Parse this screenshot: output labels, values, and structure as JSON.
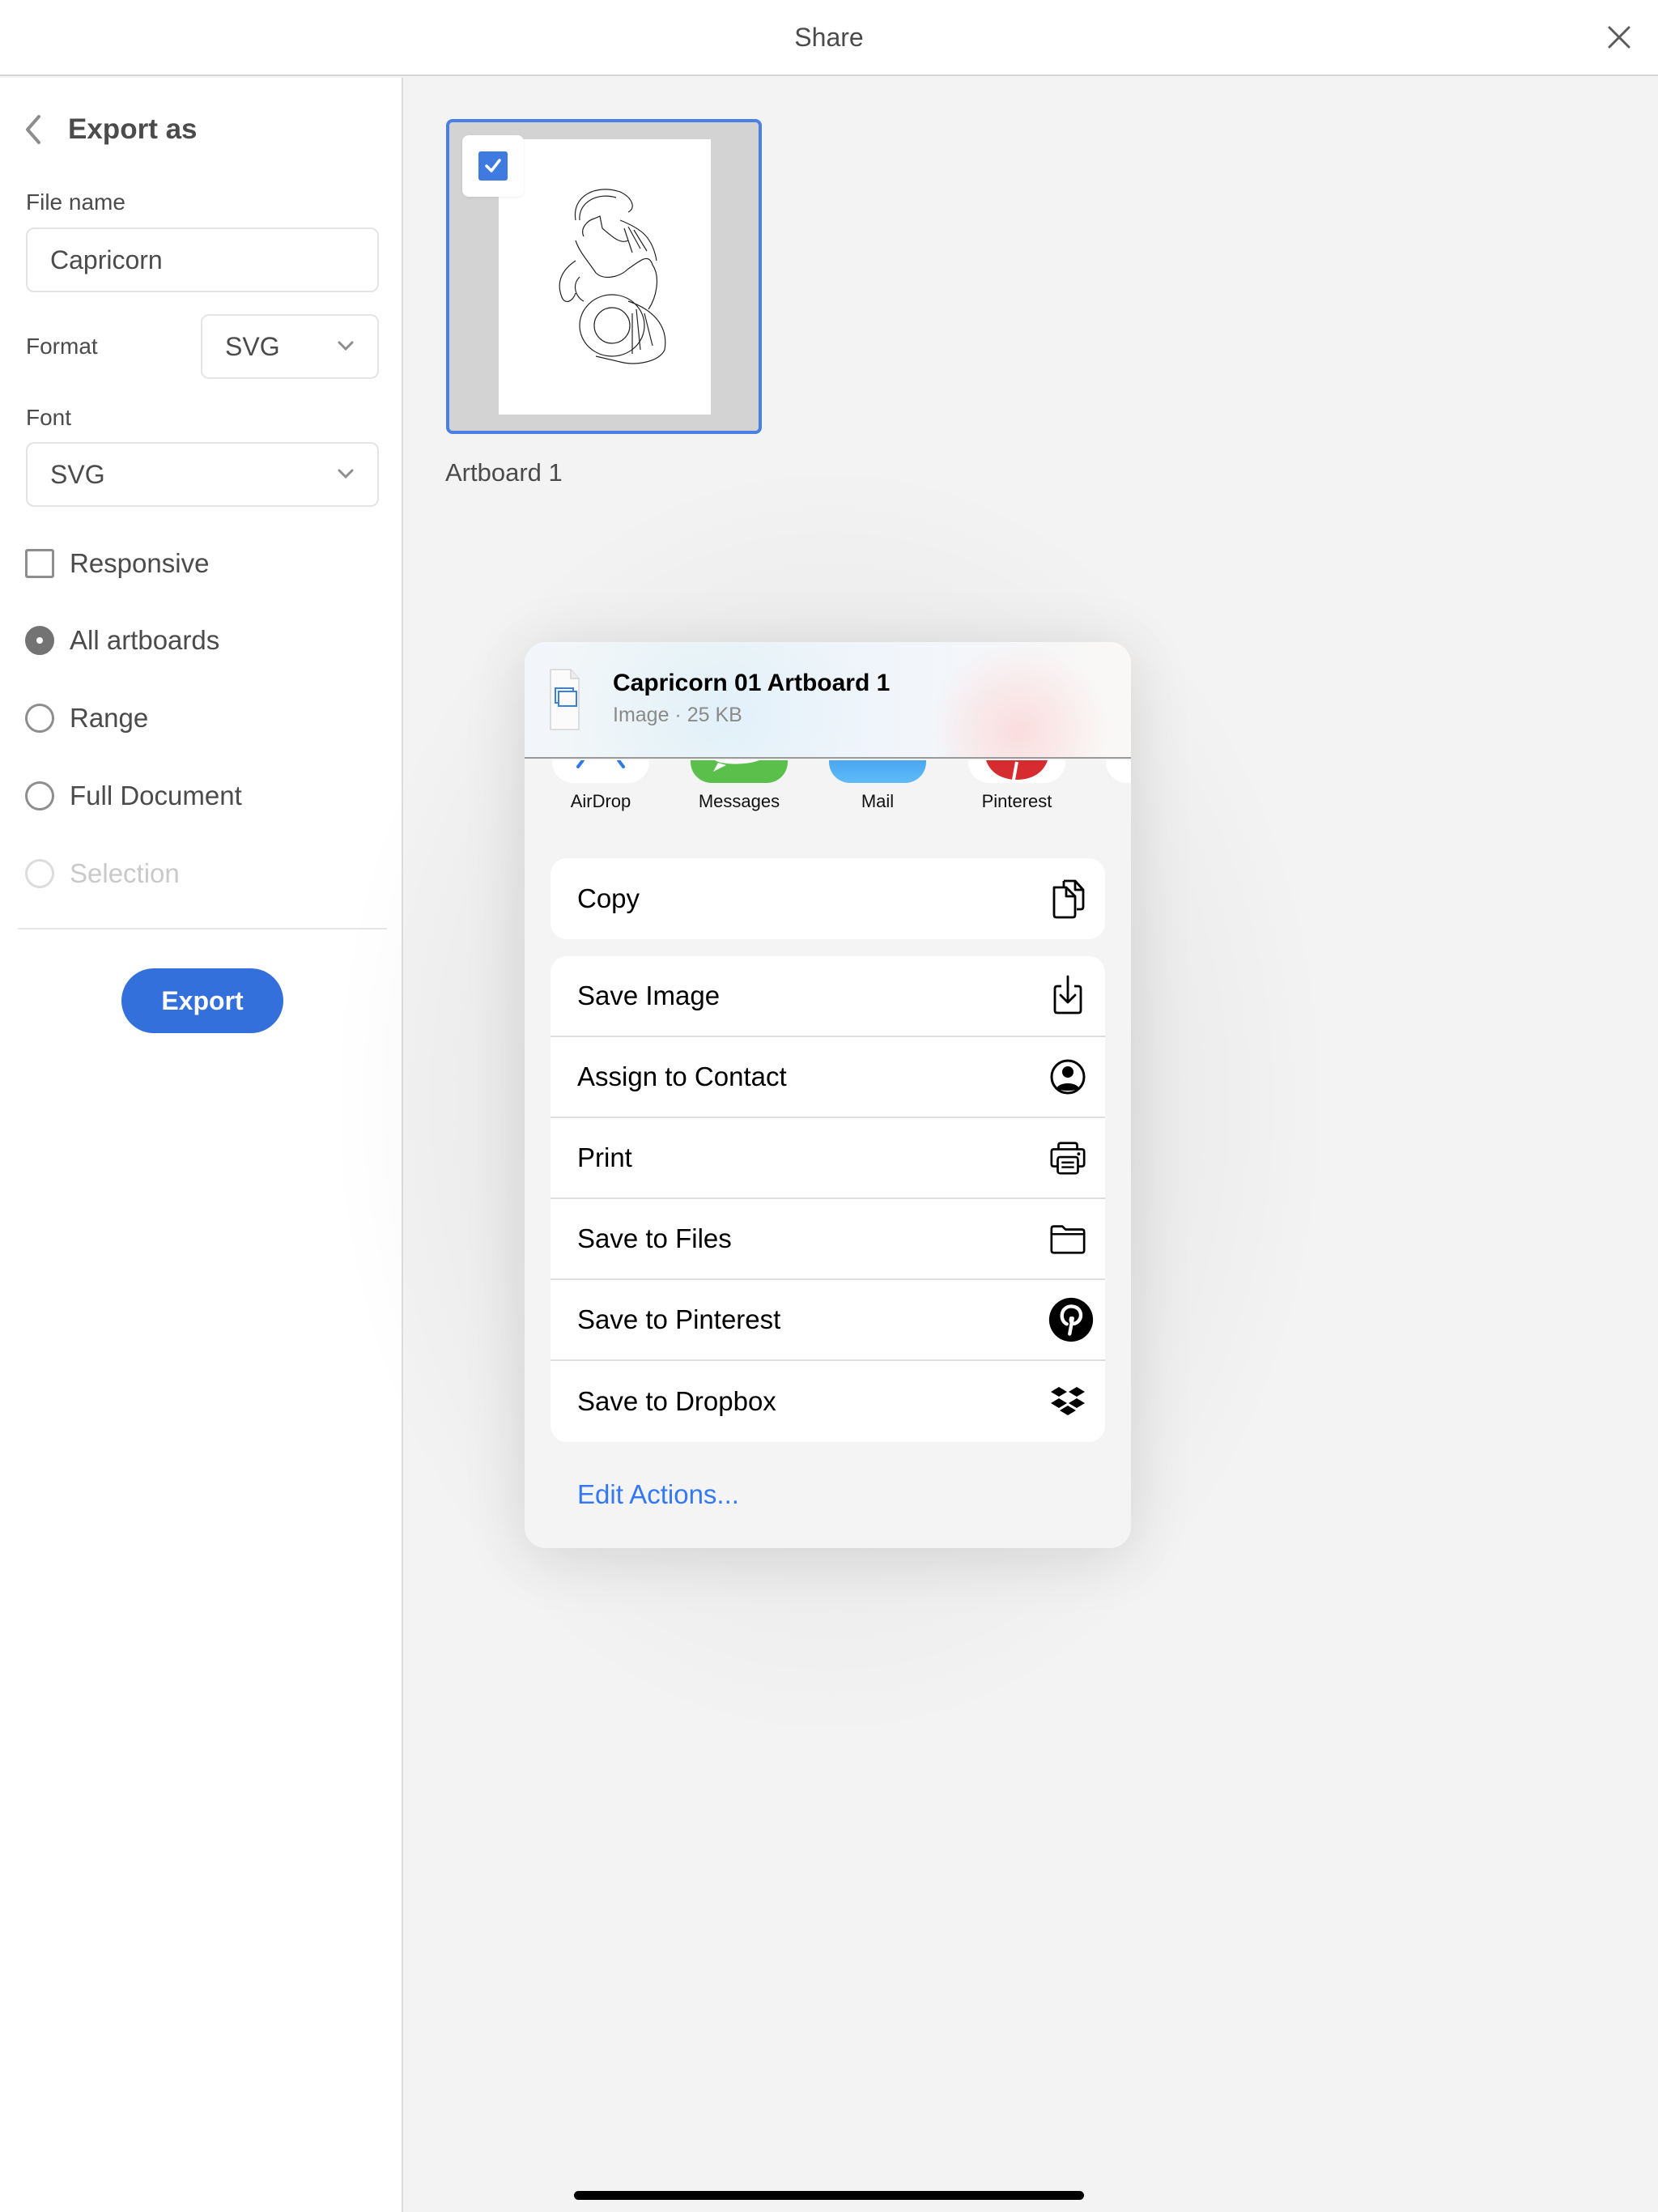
{
  "topbar": {
    "title": "Share",
    "close_icon": "close-icon"
  },
  "sidebar": {
    "heading": "Export as",
    "back_icon": "chevron-left-icon",
    "file_name": {
      "label": "File name",
      "value": "Capricorn"
    },
    "format": {
      "label": "Format",
      "value": "SVG"
    },
    "font": {
      "label": "Font",
      "value": "SVG"
    },
    "responsive": {
      "label": "Responsive",
      "checked": false
    },
    "scope_options": [
      {
        "label": "All artboards",
        "selected": true,
        "disabled": false
      },
      {
        "label": "Range",
        "selected": false,
        "disabled": false
      },
      {
        "label": "Full Document",
        "selected": false,
        "disabled": false
      },
      {
        "label": "Selection",
        "selected": false,
        "disabled": true
      }
    ],
    "export_label": "Export"
  },
  "artboards": [
    {
      "label": "Artboard 1",
      "selected": true,
      "thumbnail": "capricorn-line-art"
    }
  ],
  "share_sheet": {
    "title": "Capricorn 01 Artboard 1",
    "subtitle": "Image · 25 KB",
    "apps": [
      {
        "name": "AirDrop",
        "icon": "airdrop-icon",
        "color": "#ffffff"
      },
      {
        "name": "Messages",
        "icon": "messages-icon",
        "color": "#5ac04b"
      },
      {
        "name": "Mail",
        "icon": "mail-icon",
        "color": "#52b2f5"
      },
      {
        "name": "Pinterest",
        "icon": "pinterest-icon",
        "color": "#ffffff"
      },
      {
        "name": "",
        "icon": "more-app-icon",
        "color": "#ffffff"
      }
    ],
    "primary_actions": [
      {
        "label": "Copy",
        "icon": "copy-icon"
      }
    ],
    "actions": [
      {
        "label": "Save Image",
        "icon": "save-image-icon"
      },
      {
        "label": "Assign to Contact",
        "icon": "contact-icon"
      },
      {
        "label": "Print",
        "icon": "printer-icon"
      },
      {
        "label": "Save to Files",
        "icon": "folder-icon"
      },
      {
        "label": "Save to Pinterest",
        "icon": "pinterest-icon"
      },
      {
        "label": "Save to Dropbox",
        "icon": "dropbox-icon"
      }
    ],
    "edit_actions_label": "Edit Actions..."
  },
  "colors": {
    "accent": "#3470dc",
    "link": "#3478f6",
    "artboard_border": "#4a80e4"
  }
}
